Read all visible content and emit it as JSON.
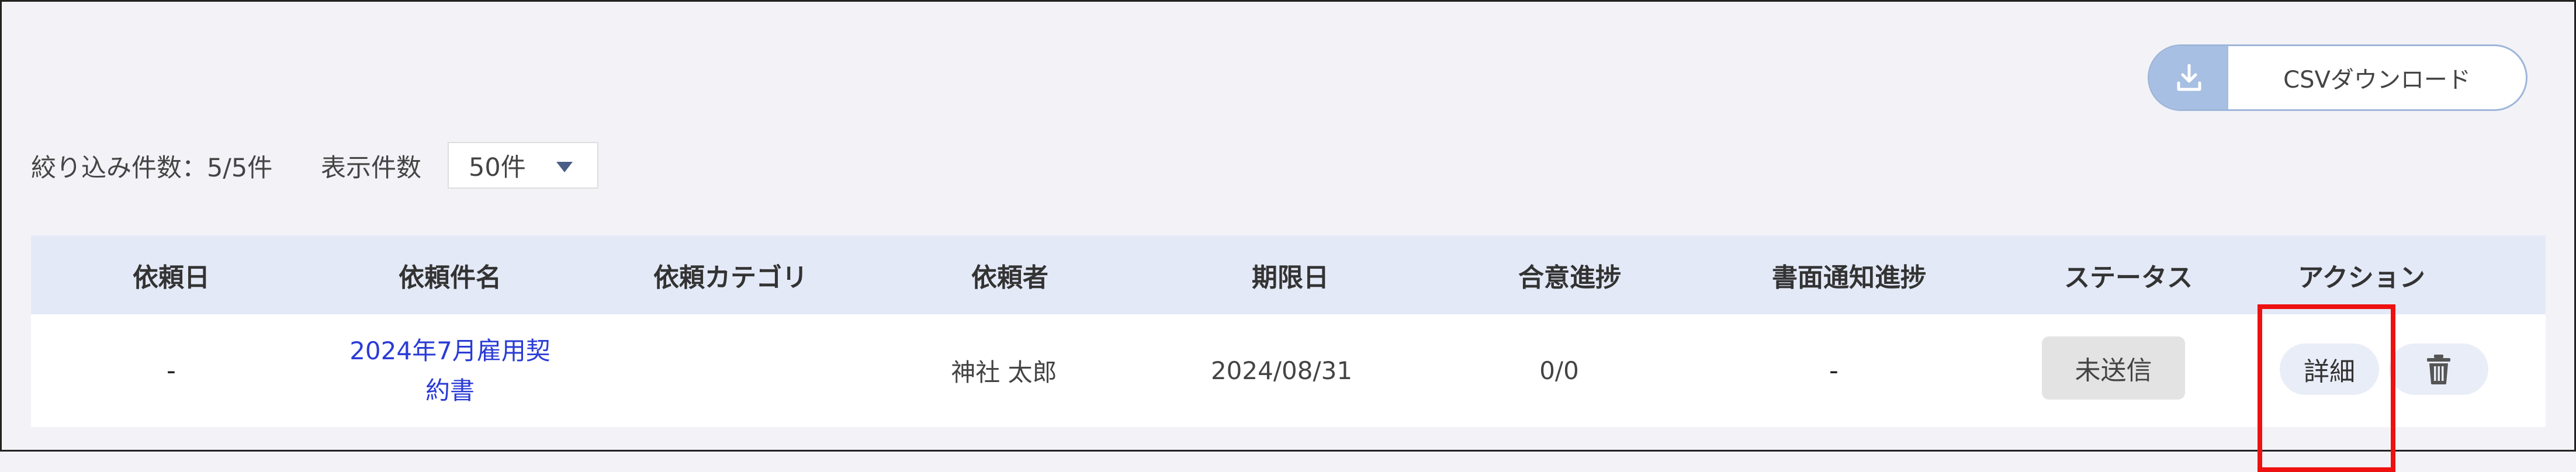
{
  "toolbar": {
    "csv_button_label": "CSVダウンロード",
    "download_icon": "download-icon"
  },
  "filter": {
    "count_label": "絞り込み件数：5/5件",
    "per_page_label": "表示件数",
    "per_page_value": "50件"
  },
  "table": {
    "headers": [
      "依頼日",
      "依頼件名",
      "依頼カテゴリ",
      "依頼者",
      "期限日",
      "合意進捗",
      "書面通知進捗",
      "ステータス",
      "アクション"
    ],
    "rows": [
      {
        "request_date": "-",
        "title": "2024年7月雇用契約書",
        "category": "",
        "requester": "神社 太郎",
        "due_date": "2024/08/31",
        "agreement_progress": "0/0",
        "notice_progress": "-",
        "status": "未送信",
        "detail_label": "詳細",
        "delete_icon": "trash-icon"
      }
    ]
  },
  "colors": {
    "header_bg": "#e4e9f7",
    "link": "#2a3bd6",
    "highlight": "#ee1111",
    "csv_icon_bg": "#a7bfe3"
  }
}
